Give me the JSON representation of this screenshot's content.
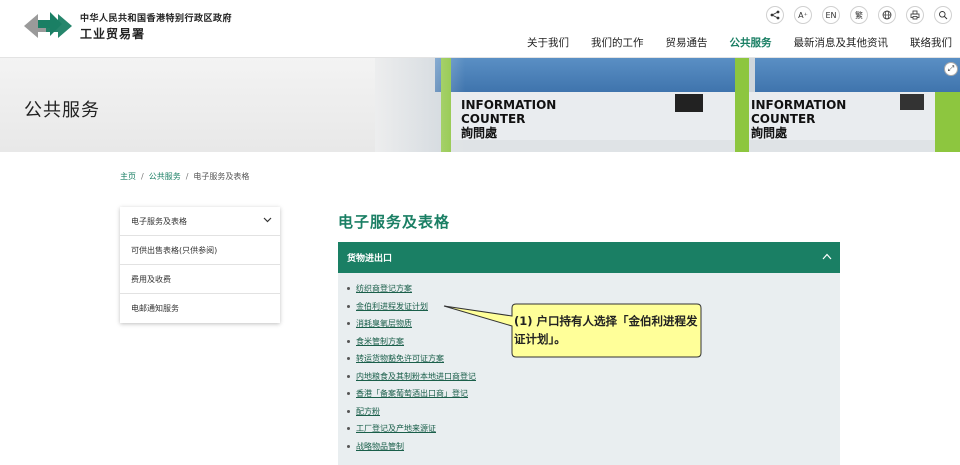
{
  "header": {
    "gov_name": "中华人民共和国香港特别行政区政府",
    "dept_name": "工业贸易署",
    "tools": [
      {
        "name": "share-icon"
      },
      {
        "name": "font-size-icon",
        "label": "A⁺"
      },
      {
        "name": "lang-en",
        "label": "EN"
      },
      {
        "name": "lang-tc",
        "label": "繁"
      },
      {
        "name": "globe-icon"
      },
      {
        "name": "print-icon"
      },
      {
        "name": "search-icon"
      }
    ],
    "nav": [
      "关于我们",
      "我们的工作",
      "贸易通告",
      "公共服务",
      "最新消息及其他资讯",
      "联络我们"
    ],
    "active_nav": "公共服务"
  },
  "banner": {
    "title": "公共服务",
    "sign_line1": "INFORMATION",
    "sign_line2": "COUNTER",
    "sign_line3": "詢問處"
  },
  "breadcrumb": {
    "home": "主页",
    "level1": "公共服务",
    "current": "电子服务及表格",
    "sep": "/"
  },
  "side_menu": [
    "电子服务及表格",
    "可供出售表格(只供参阅)",
    "费用及收费",
    "电邮通知服务"
  ],
  "main": {
    "title": "电子服务及表格",
    "accordion_title": "货物进出口",
    "links": [
      "纺织商登记方案",
      "金伯利进程发证计划",
      "消耗臭氧层物质",
      "食米管制方案",
      "转运货物豁免许可证方案",
      "内地粮食及其制粉本地进口商登记",
      "香港「备案葡萄酒出口商」登记",
      "配方粉",
      "工厂登记及产地来源证",
      "战略物品管制"
    ]
  },
  "callout": {
    "text": "(1) 户口持有人选择「金伯利进程发证计划」。",
    "fill": "#ffff99",
    "stroke": "#333333"
  },
  "colors": {
    "brand_green": "#1a7f64",
    "accordion_bg": "#e9eef0"
  }
}
